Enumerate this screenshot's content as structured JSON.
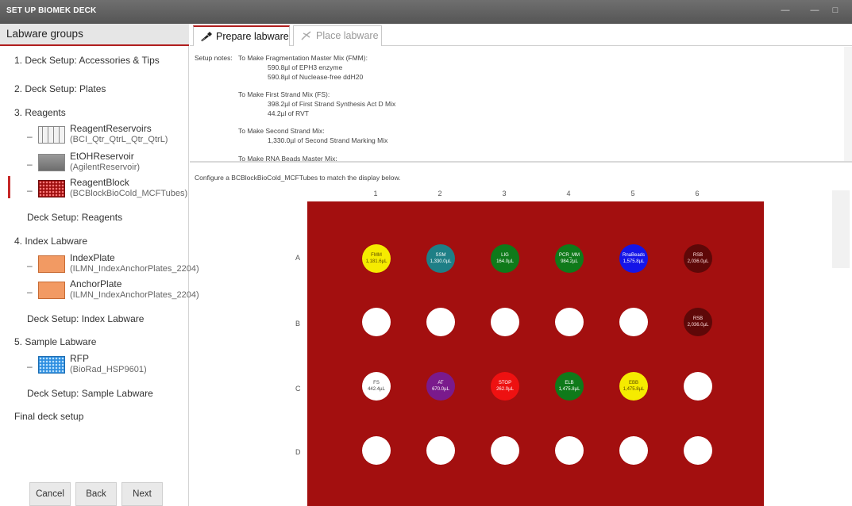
{
  "window": {
    "title": "SET UP BIOMEK DECK",
    "controls": [
      "—",
      "—",
      "□"
    ]
  },
  "sidebar": {
    "header": "Labware groups",
    "groups": [
      {
        "label": "1. Deck Setup: Accessories & Tips"
      },
      {
        "label": "2. Deck Setup: Plates"
      },
      {
        "label": "3. Reagents"
      },
      {
        "label": "4. Index Labware"
      },
      {
        "label": "5. Sample Labware"
      }
    ],
    "labware": [
      {
        "name": "ReagentReservoirs",
        "type": "(BCI_Qtr_QtrL_Qtr_QtrL)",
        "icon": "reservoir-icon"
      },
      {
        "name": "EtOHReservoir",
        "type": "(AgilentReservoir)",
        "icon": "reservoir-icon"
      },
      {
        "name": "ReagentBlock",
        "type": "(BCBlockBioCold_MCFTubes)",
        "icon": "tube-block-icon"
      },
      {
        "name": "IndexPlate",
        "type": "(ILMN_IndexAnchorPlates_2204)",
        "icon": "plate-icon"
      },
      {
        "name": "AnchorPlate",
        "type": "(ILMN_IndexAnchorPlates_2204)",
        "icon": "plate-icon"
      },
      {
        "name": "RFP",
        "type": "(BioRad_HSP9601)",
        "icon": "plate-icon"
      }
    ],
    "deck_setups": [
      "Deck Setup: Reagents",
      "Deck Setup: Index Labware",
      "Deck Setup: Sample Labware"
    ],
    "final": "Final deck setup",
    "buttons": {
      "cancel": "Cancel",
      "back": "Back",
      "next": "Next"
    }
  },
  "tabs": [
    {
      "label": "Prepare labware",
      "active": true
    },
    {
      "label": "Place labware",
      "active": false
    }
  ],
  "notes": {
    "label": "Setup notes:",
    "lines": [
      "To Make Fragmentation Master Mix (FMM):",
      "590.8µl of EPH3 enzyme",
      "590.8µl of Nuclease-free ddH20",
      "To Make First Strand Mix (FS):",
      "398.2µl of First Strand Synthesis Act D Mix",
      "44.2µl of RVT",
      "To Make Second Strand Mix:",
      "1,330.0µl of Second Strand Marking Mix",
      "To Make RNA Beads Master Mix:"
    ]
  },
  "configure_text": "Configure a BCBlockBioCold_MCFTubes to match the display below.",
  "grid": {
    "columns": [
      "1",
      "2",
      "3",
      "4",
      "5",
      "6"
    ],
    "rows": [
      "A",
      "B",
      "C",
      "D"
    ],
    "wells": [
      {
        "row": 0,
        "col": 0,
        "name": "FMM",
        "volume": "1,181.6µL",
        "color": "#f5eb00",
        "text_color": "#5a4a00"
      },
      {
        "row": 0,
        "col": 1,
        "name": "SSM",
        "volume": "1,330.0µL",
        "color": "#1e7f86",
        "text_color": "#ffffff"
      },
      {
        "row": 0,
        "col": 2,
        "name": "LIG",
        "volume": "164.0µL",
        "color": "#0f7a1a",
        "text_color": "#ffffff"
      },
      {
        "row": 0,
        "col": 3,
        "name": "PCR_MM",
        "volume": "984.2µL",
        "color": "#0f7a1a",
        "text_color": "#ffffff"
      },
      {
        "row": 0,
        "col": 4,
        "name": "RnaBeads",
        "volume": "1,575.8µL",
        "color": "#1515e8",
        "text_color": "#ffffff"
      },
      {
        "row": 0,
        "col": 5,
        "name": "RSB",
        "volume": "2,036.0µL",
        "color": "#5e0808",
        "text_color": "#ffdede"
      },
      {
        "row": 1,
        "col": 0
      },
      {
        "row": 1,
        "col": 1
      },
      {
        "row": 1,
        "col": 2
      },
      {
        "row": 1,
        "col": 3
      },
      {
        "row": 1,
        "col": 4
      },
      {
        "row": 1,
        "col": 5,
        "name": "RSB",
        "volume": "2,036.0µL",
        "color": "#5e0808",
        "text_color": "#ffdede"
      },
      {
        "row": 2,
        "col": 0,
        "name": "FS",
        "volume": "442.4µL",
        "color": "#ffffff",
        "text_color": "#444444"
      },
      {
        "row": 2,
        "col": 1,
        "name": "AT",
        "volume": "670.0µL",
        "color": "#7a1a8c",
        "text_color": "#ffffff"
      },
      {
        "row": 2,
        "col": 2,
        "name": "STOP",
        "volume": "262.0µL",
        "color": "#ee1111",
        "text_color": "#ffffff"
      },
      {
        "row": 2,
        "col": 3,
        "name": "ELB",
        "volume": "1,475.8µL",
        "color": "#0f7a1a",
        "text_color": "#ffffff"
      },
      {
        "row": 2,
        "col": 4,
        "name": "EBB",
        "volume": "1,475.8µL",
        "color": "#f5eb00",
        "text_color": "#5a4a00"
      },
      {
        "row": 2,
        "col": 5
      },
      {
        "row": 3,
        "col": 0
      },
      {
        "row": 3,
        "col": 1
      },
      {
        "row": 3,
        "col": 2
      },
      {
        "row": 3,
        "col": 3
      },
      {
        "row": 3,
        "col": 4
      },
      {
        "row": 3,
        "col": 5
      }
    ]
  },
  "colors": {
    "accent": "#b01e1e",
    "rack": "#a30f0f",
    "empty_well": "#ffffff"
  }
}
